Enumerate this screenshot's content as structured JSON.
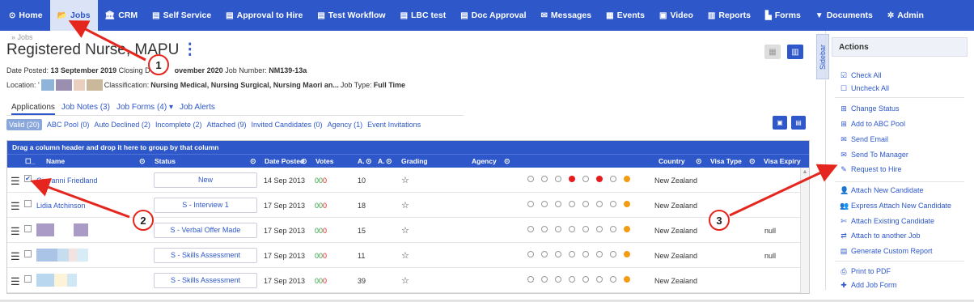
{
  "nav": {
    "items": [
      {
        "icon": "home-icon",
        "glyph": "⊙",
        "label": "Home"
      },
      {
        "icon": "folder-icon",
        "glyph": "📂",
        "label": "Jobs"
      },
      {
        "icon": "bank-icon",
        "glyph": "🏛",
        "label": "CRM"
      },
      {
        "icon": "form-icon",
        "glyph": "▤",
        "label": "Self Service"
      },
      {
        "icon": "form-icon",
        "glyph": "▤",
        "label": "Approval to Hire"
      },
      {
        "icon": "form-icon",
        "glyph": "▤",
        "label": "Test Workflow"
      },
      {
        "icon": "form-icon",
        "glyph": "▤",
        "label": "LBC test"
      },
      {
        "icon": "form-icon",
        "glyph": "▤",
        "label": "Doc Approval"
      },
      {
        "icon": "envelope-icon",
        "glyph": "✉",
        "label": "Messages"
      },
      {
        "icon": "calendar-icon",
        "glyph": "▦",
        "label": "Events"
      },
      {
        "icon": "video-icon",
        "glyph": "▣",
        "label": "Video"
      },
      {
        "icon": "report-icon",
        "glyph": "▥",
        "label": "Reports"
      },
      {
        "icon": "document-icon",
        "glyph": "▙",
        "label": "Forms"
      },
      {
        "icon": "filter-icon",
        "glyph": "▼",
        "label": "Documents"
      },
      {
        "icon": "gear-icon",
        "glyph": "✲",
        "label": "Admin"
      }
    ],
    "active_index": 1
  },
  "breadcrumb": "» Jobs",
  "page_title": "Registered Nurse, MAPU",
  "title_menu": "⋮",
  "meta": {
    "date_posted_label": "Date Posted:",
    "date_posted": "13 September 2019",
    "closing_label": "Closing D",
    "closing_date": "ovember 2020",
    "job_number_label": "Job Number:",
    "job_number": "NM139-13a",
    "location_label": "Location: '",
    "classification_label": "Classification:",
    "classification": "Nursing Medical, Nursing Surgical, Nursing Maori an...",
    "job_type_label": "Job Type:",
    "job_type": "Full Time"
  },
  "sidebar_tab": "Sidebar",
  "tabs": [
    "Applications",
    "Job Notes (3)",
    "Job Forms (4) ▾",
    "Job Alerts"
  ],
  "subtabs": [
    "Valid (20)",
    "ABC Pool (0)",
    "Auto Declined (2)",
    "Incomplete (2)",
    "Attached (9)",
    "Invited Candidates (0)",
    "Agency (1)",
    "Event Invitations"
  ],
  "grid": {
    "group_hint": "Drag a column header and drop it here to group by that column",
    "columns": {
      "name": "Name",
      "status": "Status",
      "date_posted": "Date Posted",
      "votes": "Votes",
      "a1": "A.",
      "a2": "A.",
      "grading": "Grading",
      "agency": "Agency",
      "country": "Country",
      "visa_type": "Visa Type",
      "visa_expiry": "Visa Expiry"
    },
    "rows": [
      {
        "name": "Giovanni Friedland",
        "checked": true,
        "status": "New",
        "date": "14 Sep 2013",
        "v1": "0",
        "v2": "0",
        "v3": "0",
        "a": "10",
        "grade": "☆",
        "dots": [
          "e",
          "e",
          "e",
          "r",
          "e",
          "r",
          "e",
          "o"
        ],
        "country": "New Zealand",
        "visa": ""
      },
      {
        "name": "Lidia Atchinson",
        "checked": false,
        "status": "S - Interview 1",
        "date": "17 Sep 2013",
        "v1": "0",
        "v2": "0",
        "v3": "0",
        "a": "18",
        "grade": "☆",
        "dots": [
          "e",
          "e",
          "e",
          "e",
          "e",
          "e",
          "e",
          "o"
        ],
        "country": "New Zealand",
        "visa": ""
      },
      {
        "name": "",
        "checked": false,
        "status": "S - Verbal Offer Made",
        "date": "17 Sep 2013",
        "v1": "0",
        "v2": "0",
        "v3": "0",
        "a": "15",
        "grade": "☆",
        "dots": [
          "e",
          "e",
          "e",
          "e",
          "e",
          "e",
          "e",
          "o"
        ],
        "country": "New Zealand",
        "visa": "null"
      },
      {
        "name": "",
        "checked": false,
        "status": "S - Skills Assessment",
        "date": "17 Sep 2013",
        "v1": "0",
        "v2": "0",
        "v3": "0",
        "a": "11",
        "grade": "☆",
        "dots": [
          "e",
          "e",
          "e",
          "e",
          "e",
          "e",
          "e",
          "o"
        ],
        "country": "New Zealand",
        "visa": "null"
      },
      {
        "name": "",
        "checked": false,
        "status": "S - Skills Assessment",
        "date": "17 Sep 2013",
        "v1": "0",
        "v2": "0",
        "v3": "0",
        "a": "39",
        "grade": "☆",
        "dots": [
          "e",
          "e",
          "e",
          "e",
          "e",
          "e",
          "e",
          "o"
        ],
        "country": "New Zealand",
        "visa": ""
      }
    ]
  },
  "actions": {
    "title": "Actions",
    "items": [
      {
        "icon": "check-square-icon",
        "glyph": "☑",
        "label": "Check All"
      },
      {
        "icon": "square-icon",
        "glyph": "☐",
        "label": "Uncheck All"
      },
      {
        "icon": "plus-square-icon",
        "glyph": "⊞",
        "label": "Change Status"
      },
      {
        "icon": "plus-square-icon",
        "glyph": "⊞",
        "label": "Add to ABC Pool"
      },
      {
        "icon": "envelope-icon",
        "glyph": "✉",
        "label": "Send Email"
      },
      {
        "icon": "envelope-icon",
        "glyph": "✉",
        "label": "Send To Manager"
      },
      {
        "icon": "pencil-icon",
        "glyph": "✎",
        "label": "Request to Hire"
      },
      {
        "icon": "user-icon",
        "glyph": "👤",
        "label": "Attach New Candidate"
      },
      {
        "icon": "users-icon",
        "glyph": "👥",
        "label": "Express Attach New Candidate"
      },
      {
        "icon": "paperclip-icon",
        "glyph": "✄",
        "label": "Attach Existing Candidate"
      },
      {
        "icon": "exchange-icon",
        "glyph": "⇄",
        "label": "Attach to another Job"
      },
      {
        "icon": "report-icon",
        "glyph": "▤",
        "label": "Generate Custom Report"
      },
      {
        "icon": "print-icon",
        "glyph": "⎙",
        "label": "Print to PDF"
      },
      {
        "icon": "plus-icon",
        "glyph": "✚",
        "label": "Add Job Form"
      }
    ]
  },
  "callouts": [
    "1",
    "2",
    "3"
  ],
  "colors": {
    "nav": "#2e57c9",
    "annotation": "#e5261e",
    "status_orange": "#f39c12",
    "status_red": "#e81b1b"
  }
}
